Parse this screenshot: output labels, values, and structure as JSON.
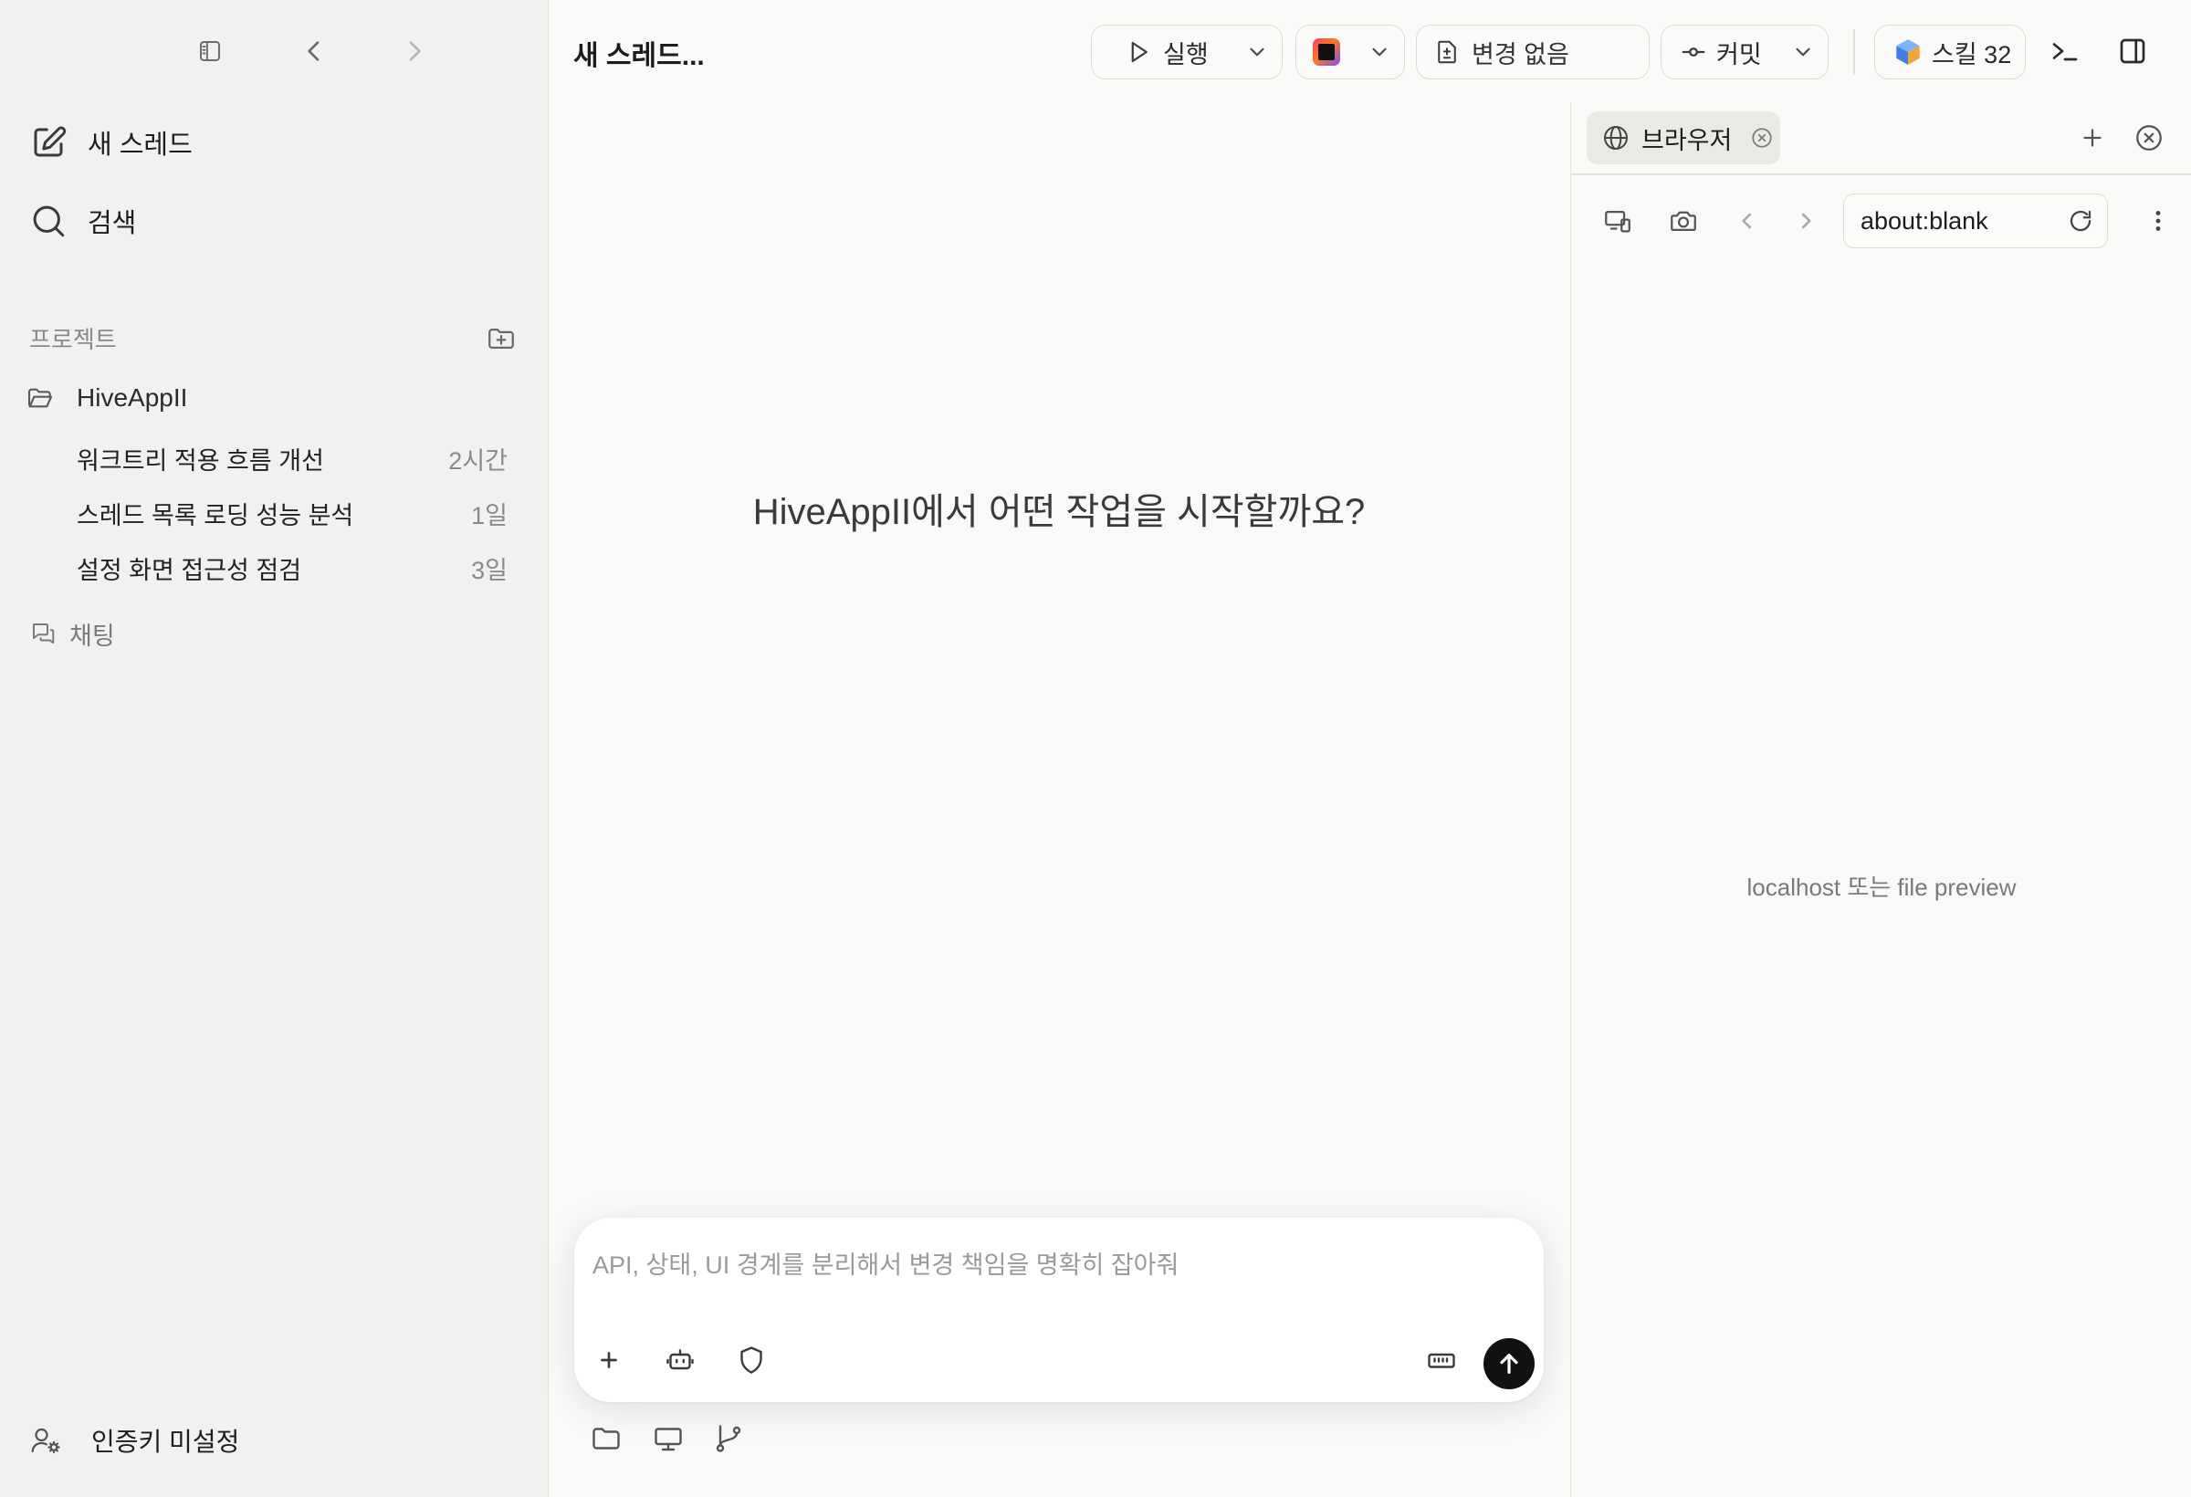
{
  "sidebar": {
    "new_thread": "새 스레드",
    "search": "검색",
    "projects_label": "프로젝트",
    "project": {
      "name": "HiveAppII",
      "icon": "folder-open-icon"
    },
    "threads": [
      {
        "title": "워크트리 적용 흐름 개선",
        "age": "2시간"
      },
      {
        "title": "스레드 목록 로딩 성능 분석",
        "age": "1일"
      },
      {
        "title": "설정 화면 접근성 점검",
        "age": "3일"
      }
    ],
    "chat": "채팅",
    "account": "인증키 미설정"
  },
  "header": {
    "thread_title": "새 스레드...",
    "run_label": "실행",
    "changes_label": "변경 없음",
    "commit_label": "커밋",
    "skills_label": "스킬 32"
  },
  "main": {
    "hero": "HiveAppII에서 어떤 작업을 시작할까요?",
    "composer_placeholder": "API, 상태, UI 경계를 분리해서 변경 책임을 명확히 잡아줘"
  },
  "browser": {
    "tab_label": "브라우저",
    "url": "about:blank",
    "preview_hint": "localhost 또는 file preview"
  },
  "colors": {
    "sidebar_bg": "#f1f1ef",
    "main_bg": "#f9f9f7",
    "send_button": "#111111",
    "ide_icon": "#e8422f",
    "skills_icon": "#4c8df6"
  }
}
